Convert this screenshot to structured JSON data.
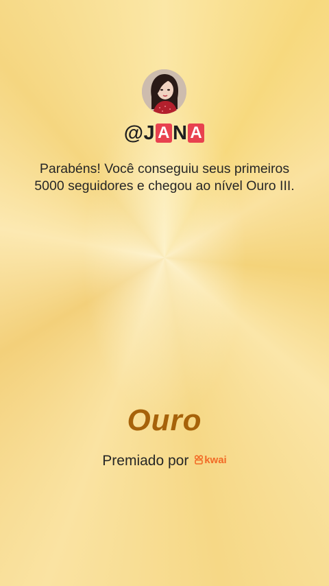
{
  "profile": {
    "username_prefix": "@J",
    "username_badge_1": "A",
    "username_middle": "N",
    "username_badge_2": "A"
  },
  "message": "Parabéns! Você conseguiu seus primeiros 5000 seguidores e chegou ao nível Ouro III.",
  "level": {
    "title": "Ouro"
  },
  "award": {
    "label": "Premiado por",
    "brand": "kwai"
  },
  "colors": {
    "gold_title": "#a6620a",
    "brand_orange": "#f26a26",
    "badge_red": "#e8414f"
  }
}
